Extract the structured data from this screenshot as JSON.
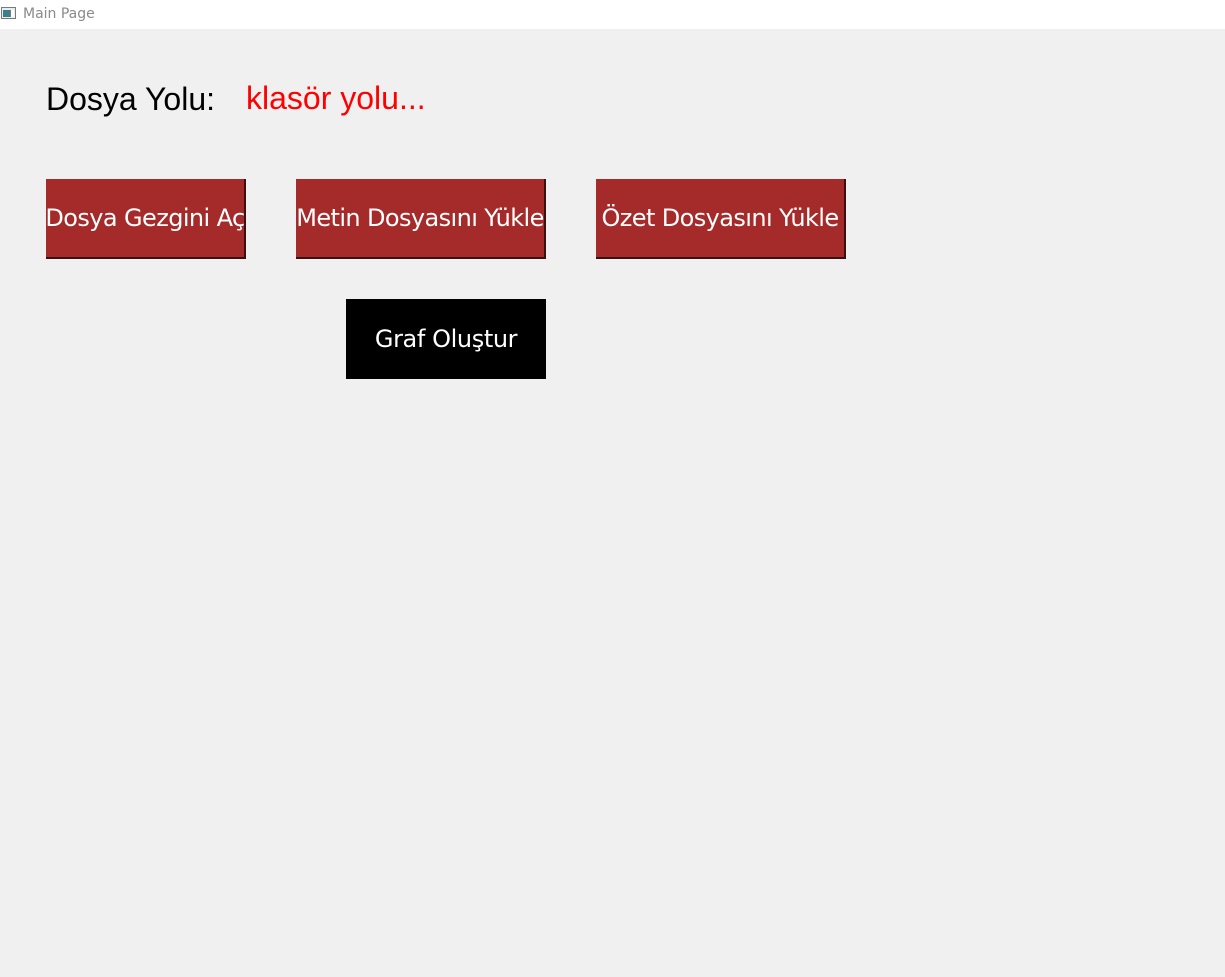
{
  "window": {
    "title": "Main Page",
    "icon": "app-window-icon"
  },
  "file_path": {
    "label": "Dosya Yolu:",
    "value": "klasör yolu...",
    "label_color": "#000000",
    "value_color": "#ff0000"
  },
  "buttons": {
    "open_explorer": "Dosya Gezgini Aç",
    "load_text": "Metin Dosyasını Yükle",
    "load_summary": "Özet Dosyasını Yükle",
    "create_graph": "Graf Oluştur"
  },
  "colors": {
    "background": "#f0f0f0",
    "button_red": "#a52a2a",
    "button_black": "#000000",
    "button_text": "#ffffff"
  }
}
